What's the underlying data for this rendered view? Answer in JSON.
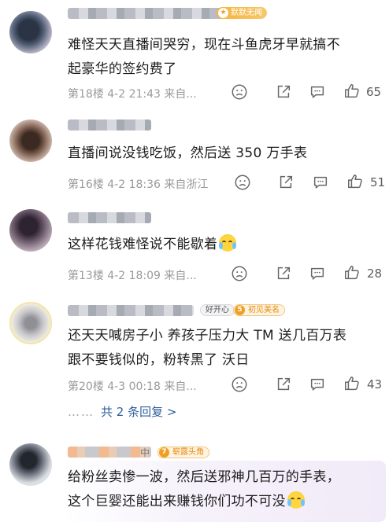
{
  "comments": [
    {
      "badge": "默默无闻",
      "text_lines": [
        "难怪天天直播间哭穷，现在斗鱼虎牙早就搞不",
        "起豪华的签约费了"
      ],
      "meta": "第18楼 4-2 21:43 来自...",
      "likes": "65",
      "avatar_icon": "avatar-blurred"
    },
    {
      "text_lines": [
        "直播间说没钱吃饭，然后送 350 万手表"
      ],
      "meta": "第16楼 4-2 18:36 来自浙江",
      "likes": "51",
      "avatar_icon": "avatar-blurred"
    },
    {
      "text_lines": [
        "这样花钱难怪说不能歇着"
      ],
      "meta": "第13楼 4-2 18:09 来自...",
      "likes": "28",
      "avatar_icon": "avatar-blurred"
    },
    {
      "badge_plain": "好开心",
      "badge_level": "5",
      "badge_orange": "初见美名",
      "text_lines": [
        "还天天喊房子小 养孩子压力大 TM 送几百万表",
        "跟不要钱似的，粉转黑了 沃日"
      ],
      "meta": "第20楼 4-3 00:18 来自...",
      "likes": "43",
      "avatar_icon": "avatar-blurred"
    },
    {
      "name_suffix": "中",
      "badge_level": "7",
      "badge_orange": "崭露头角",
      "text_lines": [
        "给粉丝卖惨一波，然后送邪神几百万的手表，",
        "这个巨婴还能出来赚钱你们功不可没"
      ],
      "avatar_icon": "avatar-anime"
    }
  ],
  "more_replies": {
    "dots": "……",
    "label": "共 2 条回复 >"
  },
  "icons": {
    "dislike": "frown-icon",
    "share": "share-icon",
    "reply": "comment-icon",
    "like": "thumbs-up-icon",
    "emoji": "crying-laughing-emoji"
  },
  "colors": {
    "badge_gold": "#f7b23b",
    "badge_orange": "#e58a10",
    "link": "#2e5e9e",
    "meta_gray": "#9a9a9a"
  }
}
